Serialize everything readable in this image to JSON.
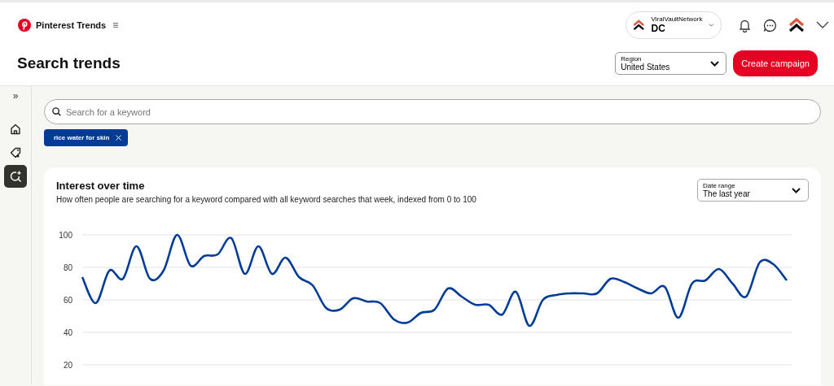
{
  "header": {
    "brand": "Pinterest Trends",
    "menu_glyph": "≡",
    "page_title": "Search trends",
    "account": {
      "label": "ViralVaultNetwork",
      "name": "DC"
    },
    "region": {
      "label": "Region",
      "value": "United States"
    },
    "create_button": "Create campaign"
  },
  "sidebar": {
    "expand_glyph": "»",
    "items": [
      {
        "kind": "home",
        "selected": false
      },
      {
        "kind": "tag",
        "selected": false
      },
      {
        "kind": "trends",
        "selected": true
      }
    ]
  },
  "search": {
    "placeholder": "Search for a keyword"
  },
  "keywords": [
    {
      "label": "rice water for skin"
    }
  ],
  "interest_card": {
    "title": "Interest over time",
    "subtitle": "How often people are searching for a keyword compared with all keyword searches that week, indexed from 0 to 100",
    "date_range": {
      "label": "Date range",
      "value": "The last year"
    },
    "chart_data": {
      "type": "line",
      "ylim": [
        20,
        100
      ],
      "grid": true,
      "yticks": [
        20,
        40,
        60,
        80,
        100
      ],
      "series": [
        {
          "color": "#003c96",
          "values": [
            74,
            58,
            78,
            73,
            93,
            73,
            78,
            100,
            81,
            87,
            88,
            98,
            76,
            93,
            76,
            86,
            74,
            69,
            55,
            54,
            61,
            59,
            58,
            48,
            46,
            52,
            54,
            67,
            62,
            57,
            57,
            51,
            65,
            44,
            60,
            63,
            64,
            64,
            64,
            73,
            71,
            67,
            64,
            68,
            49,
            70,
            72,
            79,
            70,
            62,
            83,
            82,
            72
          ]
        }
      ]
    }
  }
}
